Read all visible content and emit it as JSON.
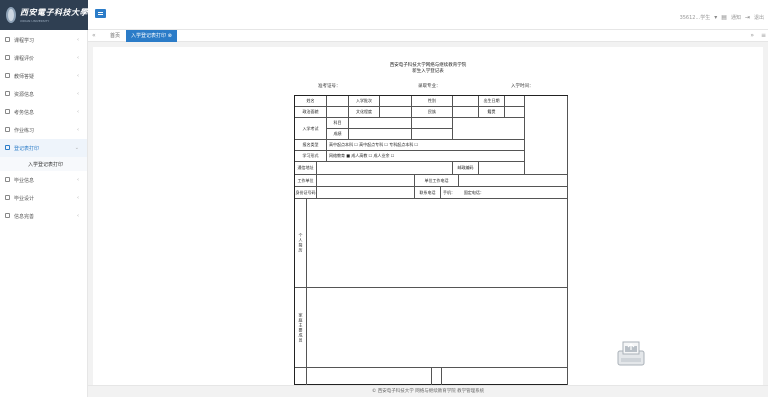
{
  "app": {
    "logo_text": "西安電子科技大學",
    "logo_subtext": "XIDIAN UNIVERSITY"
  },
  "topbar": {
    "user": "35612...学生",
    "notice": "通知",
    "logout": "退出"
  },
  "sidebar": {
    "items": [
      {
        "label": "课程学习"
      },
      {
        "label": "课程评价"
      },
      {
        "label": "教师答疑"
      },
      {
        "label": "资源信息"
      },
      {
        "label": "考务信息"
      },
      {
        "label": "作业练习"
      },
      {
        "label": "登记表打印",
        "active": true,
        "sub": [
          "入学登记表打印"
        ]
      },
      {
        "label": "毕业信息"
      },
      {
        "label": "毕业设计"
      },
      {
        "label": "信息完善"
      }
    ]
  },
  "tabs": {
    "home": "首页",
    "current": "入学登记表打印"
  },
  "form": {
    "title1": "西安电子科技大学网络与继续教育学院",
    "title2": "新生入学登记表",
    "meta_exam_no": "准考证号：",
    "meta_major": "录取专业：",
    "meta_date": "入学时间：",
    "name": "姓名",
    "gender": "入学批次",
    "ethnicity": "性别",
    "birth": "出生日期",
    "politics": "政治面貌",
    "education": "文化程度",
    "nation": "民族",
    "marital": "籍贯",
    "admission": "入学考试",
    "subject": "科目",
    "score": "成绩",
    "level": "报名类型",
    "level_opts": "高中起点本科 ☐    高中起点专科 ☐    专科起点本科 ☐",
    "study_mode": "学习形式",
    "study_opts": "网络教育 ■    成人高教 ☐    成人业余 ☐",
    "address": "通信地址",
    "postcode": "邮政编码",
    "work_unit": "工作单位",
    "unit_phone": "单位工作电话",
    "id_no": "身份证号码",
    "phone": "联系电话",
    "mobile": "手机：",
    "home_phone": "固定电话：",
    "resume": "个人简历",
    "family": "家庭主要成员"
  },
  "footer": {
    "text": "© 西安电子科技大学  网络与继续教育学院 教学管理系统"
  }
}
